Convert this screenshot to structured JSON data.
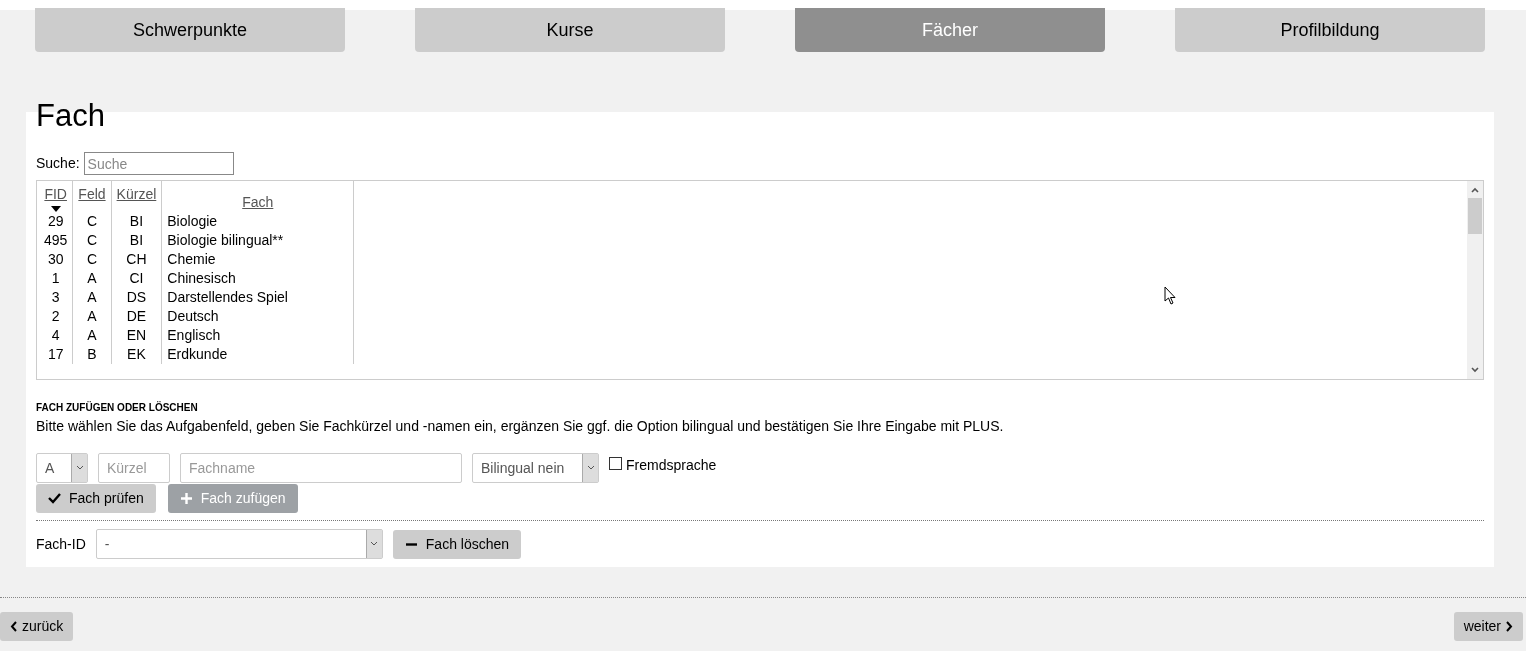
{
  "tabs": [
    {
      "label": "Schwerpunkte",
      "selected": false
    },
    {
      "label": "Kurse",
      "selected": false
    },
    {
      "label": "Fächer",
      "selected": true
    },
    {
      "label": "Profilbildung",
      "selected": false
    }
  ],
  "title": "Fach",
  "search": {
    "label": "Suche:",
    "placeholder": "Suche"
  },
  "table": {
    "columns": [
      {
        "label": "FID",
        "sorted": true
      },
      {
        "label": "Feld",
        "sorted": false
      },
      {
        "label": "Kürzel",
        "sorted": false
      },
      {
        "label": "Fach",
        "sorted": false
      }
    ],
    "rows": [
      [
        "29",
        "C",
        "BI",
        "Biologie"
      ],
      [
        "495",
        "C",
        "BI",
        "Biologie bilingual**"
      ],
      [
        "30",
        "C",
        "CH",
        "Chemie"
      ],
      [
        "1",
        "A",
        "CI",
        "Chinesisch"
      ],
      [
        "3",
        "A",
        "DS",
        "Darstellendes Spiel"
      ],
      [
        "2",
        "A",
        "DE",
        "Deutsch"
      ],
      [
        "4",
        "A",
        "EN",
        "Englisch"
      ],
      [
        "17",
        "B",
        "EK",
        "Erdkunde"
      ]
    ]
  },
  "add_section": {
    "heading": "FACH ZUFÜGEN ODER LÖSCHEN",
    "instructions": "Bitte wählen Sie das Aufgabenfeld, geben Sie Fachkürzel und -namen ein, ergänzen Sie ggf. die Option bilingual und bestätigen Sie Ihre Eingabe mit PLUS.",
    "field_select": {
      "value": "A"
    },
    "kuerzel": {
      "placeholder": "Kürzel"
    },
    "fachname": {
      "placeholder": "Fachname"
    },
    "bilingual_select": {
      "value": "Bilingual nein"
    },
    "checkbox": {
      "label": "Fremdsprache",
      "checked": false
    },
    "buttons": [
      {
        "label": "Fach prüfen",
        "kind": "check",
        "disabled": false
      },
      {
        "label": "Fach zufügen",
        "kind": "add",
        "disabled": true
      }
    ]
  },
  "delete_section": {
    "label": "Fach-ID",
    "select": {
      "value": "-"
    },
    "button": {
      "label": "Fach löschen",
      "kind": "delete",
      "disabled": false
    }
  },
  "nav": {
    "back": "zurück",
    "next": "weiter"
  }
}
